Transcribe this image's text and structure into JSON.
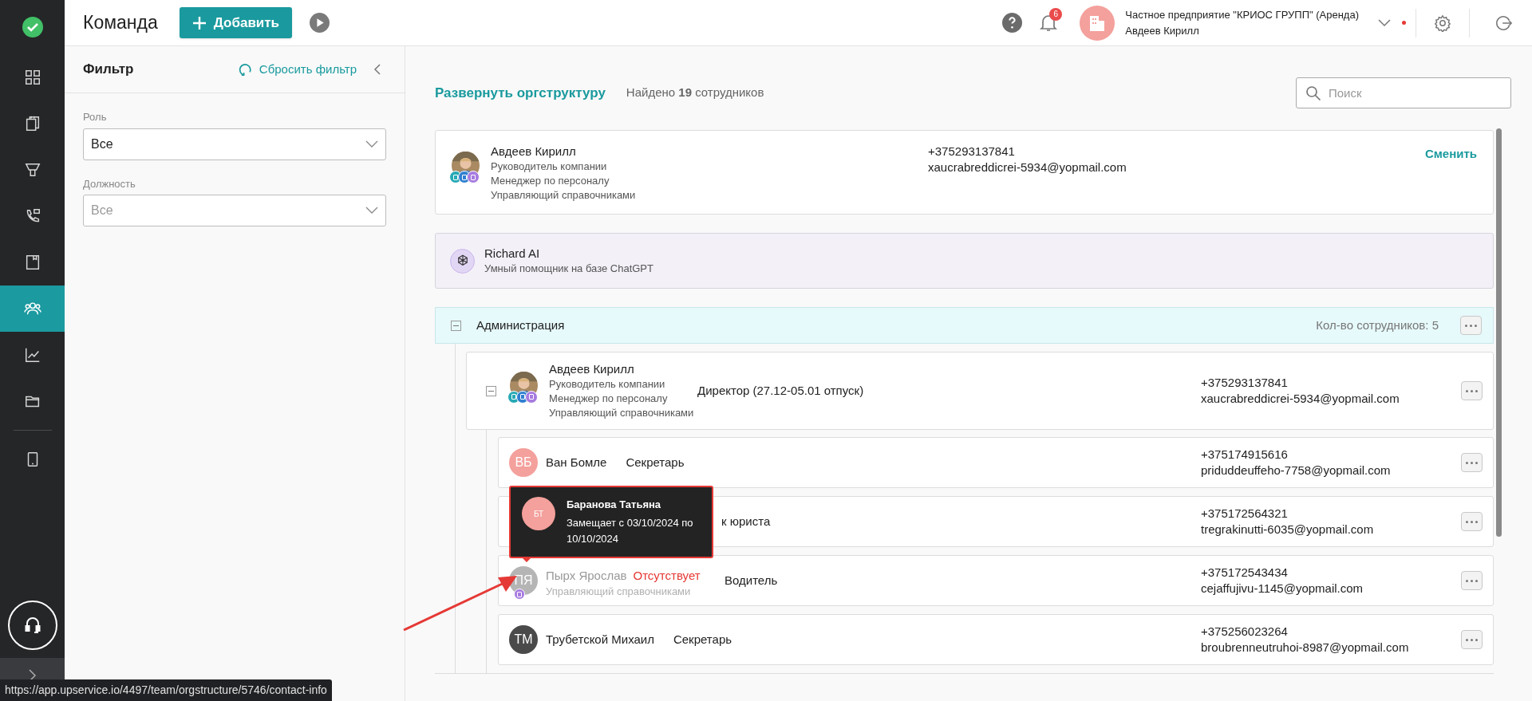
{
  "sidebar": {
    "items": [
      {
        "kind": "grid",
        "selected": false
      },
      {
        "kind": "clipboard",
        "selected": false
      },
      {
        "kind": "funnel",
        "selected": false
      },
      {
        "kind": "phone",
        "selected": false
      },
      {
        "kind": "book",
        "selected": false
      },
      {
        "kind": "team",
        "selected": true
      },
      {
        "kind": "chart",
        "selected": false
      },
      {
        "kind": "folder",
        "selected": false
      },
      {
        "kind": "tablet",
        "selected": false
      }
    ]
  },
  "header": {
    "title": "Команда",
    "add_button": "Добавить",
    "notifications": "6",
    "company": "Частное предприятие \"КРИОС ГРУПП\" (Аренда)",
    "user": "Авдеев Кирилл",
    "unread_dot": true
  },
  "filter": {
    "title": "Фильтр",
    "reset": "Сбросить фильтр",
    "fields": [
      {
        "label": "Роль",
        "value": "Все",
        "disabled": false
      },
      {
        "label": "Должность",
        "value": "Все",
        "disabled": true
      }
    ]
  },
  "main": {
    "expand_link": "Развернуть оргструктуру",
    "found": "Найдено **19** сотрудников",
    "search_placeholder": "Поиск",
    "current_user": {
      "name": "Авдеев Кирилл",
      "roles": [
        {
          "kind": "head",
          "text": "Руководитель компании"
        },
        {
          "kind": "hr",
          "text": "Менеджер по персоналу"
        },
        {
          "kind": "directory",
          "text": "Управляющий справочниками"
        }
      ],
      "phone": "+375293137841",
      "email": "xaucrabreddicrei-5934@yopmail.com",
      "action": "Сменить"
    },
    "ai": {
      "name": "Richard AI",
      "description": "Умный помощник на базе ChatGPT"
    },
    "department": {
      "name": "Администрация",
      "count": "Кол-во сотрудников: 5",
      "expanded": true,
      "head": {
        "name": "Авдеев Кирилл",
        "roles": [
          {
            "kind": "head",
            "text": "Руководитель компании"
          },
          {
            "kind": "hr",
            "text": "Менеджер по персоналу"
          },
          {
            "kind": "directory",
            "text": "Управляющий справочниками"
          }
        ],
        "position": "Директор (27.12-05.01 отпуск)",
        "phone": "+375293137841",
        "email": "xaucrabreddicrei-5934@yopmail.com",
        "expanded": true
      },
      "members": [
        {
          "kind": "normal",
          "initials": "ВБ",
          "color": "#f4a09c",
          "name": "Ван Бомле",
          "position": "Секретарь",
          "phone": "+375174915616",
          "email": "priduddeuffeho-7758@yopmail.com"
        },
        {
          "kind": "covered",
          "position": "к юриста",
          "phone": "+375172564321",
          "email": "tregrakinutti-6035@yopmail.com",
          "tooltip": {
            "initials": "БТ",
            "name": "Баранова Татьяна",
            "text": "Замещает с 03/10/2024 по 10/10/2024"
          }
        },
        {
          "kind": "absent",
          "initials": "ПЯ",
          "color": "#b5b5b5",
          "name": "Пырх Ярослав",
          "status": "Отсутствует",
          "roles": [
            {
              "kind": "directory",
              "text": "Управляющий справочниками"
            }
          ],
          "position": "Водитель",
          "phone": "+375172543434",
          "email": "cejaffujivu-1145@yopmail.com"
        },
        {
          "kind": "normal",
          "initials": "ТМ",
          "color": "#4a4a4a",
          "name": "Трубетской Михаил",
          "position": "Секретарь",
          "phone": "+375256023264",
          "email": "broubrenneutruhoi-8987@yopmail.com"
        }
      ]
    }
  },
  "status_url": "https://app.upservice.io/4497/team/orgstructure/5746/contact-info"
}
